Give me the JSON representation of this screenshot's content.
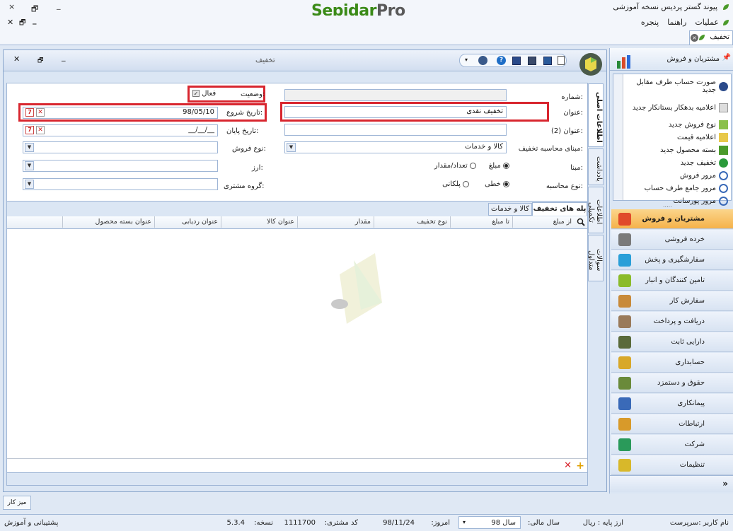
{
  "app": {
    "title": "پیوند گستر پردیس نسخه آموزشی",
    "logo_part1": "Sepidar",
    "logo_part2": "Pro"
  },
  "window_controls": {
    "close": "×",
    "restore": "🗗",
    "minimize": "_"
  },
  "menu": {
    "items": [
      "عملیات",
      "راهنما",
      "پنجره"
    ]
  },
  "doc_tab": {
    "label": "تخفیف"
  },
  "form": {
    "title": "تخفیف",
    "side_tabs": [
      "اطلاعات اصلی",
      "یادداشت",
      "اطلاعات تکمیلی",
      "سوالات متداول"
    ],
    "fields": {
      "number_label": "شماره:",
      "number_value": "",
      "title_label": "عنوان:",
      "title_value": "تخفیف نقدی",
      "title2_label": "عنوان (2):",
      "title2_value": "",
      "calc_basis_label": "مبنای محاسبه تخفیف:",
      "calc_basis_value": "کالا و خدمات",
      "basis_label": "مبنا:",
      "basis_opt1": "مبلغ",
      "basis_opt2": "تعداد/مقدار",
      "calc_type_label": "نوع محاسبه:",
      "calc_type_opt1": "خطی",
      "calc_type_opt2": "پلکانی",
      "status_label": "وضعیت:",
      "status_check": "فعال",
      "start_label": "تاریخ شروع:",
      "start_value": "98/05/10",
      "end_label": "تاریخ پایان:",
      "end_value": "__/__/__",
      "sale_type_label": "نوع فروش:",
      "currency_label": "ارز:",
      "customer_group_label": "گروه مشتری:"
    },
    "grid_tabs": [
      "پله های تخفیف",
      "کالا و خدمات"
    ],
    "grid_columns": [
      "از مبلغ",
      "تا مبلغ",
      "نوع تخفیف",
      "مقدار",
      "عنوان کالا",
      "عنوان ردیابی",
      "عنوان بسته محصول"
    ]
  },
  "sidebar": {
    "header": "مشتریان و فروش",
    "sub_items": [
      "صورت حساب طرف مقابل جدید",
      "اعلامیه بدهکار بستانکار جدید",
      "نوع فروش جدید",
      "اعلامیه قیمت",
      "بسته محصول جدید",
      "تخفیف جدید",
      "مرور فروش",
      "مرور جامع طرف حساب",
      "مرور پورسانت"
    ],
    "modules": [
      "مشتریان و فروش",
      "خرده فروشی",
      "سفارشگیری و پخش",
      "تامین کنندگان و انبار",
      "سفارش کار",
      "دریافت و پرداخت",
      "دارایی ثابت",
      "حسابداری",
      "حقوق و دستمزد",
      "پیمانکاری",
      "ارتباطات",
      "شرکت",
      "تنظیمات"
    ],
    "module_colors": [
      "#e04a2a",
      "#7a7a7a",
      "#2a9fd8",
      "#8bbb2a",
      "#c88a3a",
      "#9a7a5a",
      "#5a6a3a",
      "#d8a82a",
      "#6a8a3a",
      "#3a6ab8",
      "#d89a2a",
      "#2a9a5a",
      "#d8b82a"
    ]
  },
  "bottom_tab": "میز کار",
  "status": {
    "user": "نام کاربر :سرپرست",
    "base_currency": "ارز پایه :  ریال",
    "fiscal_year_label": "سال مالی:",
    "fiscal_year_value": "سال 98",
    "today_label": "امروز:",
    "today_value": "98/11/24",
    "customer_code_label": "کد مشتری:",
    "customer_code_value": "1111700",
    "version_label": "نسخه:",
    "version_value": "5.3.4",
    "support": "پشتیبانی و آموزش"
  }
}
